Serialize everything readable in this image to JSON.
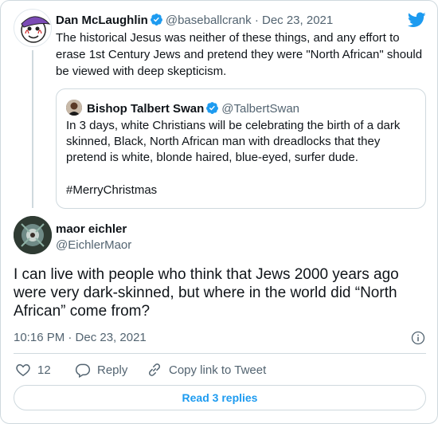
{
  "parent_tweet": {
    "author_name": "Dan McLaughlin",
    "author_handle": "@baseballcrank",
    "separator": "·",
    "date": "Dec 23, 2021",
    "text": "The historical Jesus was neither of these things, and any effort to erase 1st Century Jews and pretend they were \"North African\" should be viewed with deep skepticism."
  },
  "quoted_tweet": {
    "author_name": "Bishop Talbert Swan",
    "author_handle": "@TalbertSwan",
    "text": "In 3 days, white Christians will be celebrating the birth of a dark skinned, Black, North African man with dreadlocks that they pretend is white, blonde haired, blue-eyed, surfer dude.",
    "hashtag": "#MerryChristmas"
  },
  "main_tweet": {
    "author_name": "maor eichler",
    "author_handle": "@EichlerMaor",
    "text": "I can live with people who think that Jews 2000 years ago were very dark-skinned, but where in the world did “North African” come from?",
    "timestamp": "10:16 PM · Dec 23, 2021"
  },
  "actions": {
    "likes_count": "12",
    "reply_label": "Reply",
    "copy_link_label": "Copy link to Tweet"
  },
  "replies_button": "Read 3 replies",
  "colors": {
    "accent": "#1d9bf0",
    "secondary_text": "#536471",
    "border": "#cfd9de"
  },
  "icons": [
    "twitter-bird-icon",
    "verified-badge-icon",
    "info-icon",
    "heart-icon",
    "reply-bubble-icon",
    "link-icon"
  ]
}
